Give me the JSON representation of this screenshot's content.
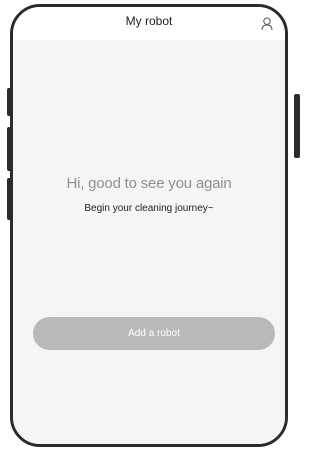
{
  "header": {
    "title": "My robot",
    "profile_icon": "user-icon"
  },
  "main": {
    "greeting": "Hi, good to see you again",
    "subtitle": "Begin your cleaning journey~",
    "add_robot_label": "Add a robot"
  },
  "colors": {
    "frame": "#2b2b2b",
    "screen_background": "#f5f5f5",
    "button_background": "#b9b9b9",
    "greeting_text": "#8f8f8f"
  }
}
